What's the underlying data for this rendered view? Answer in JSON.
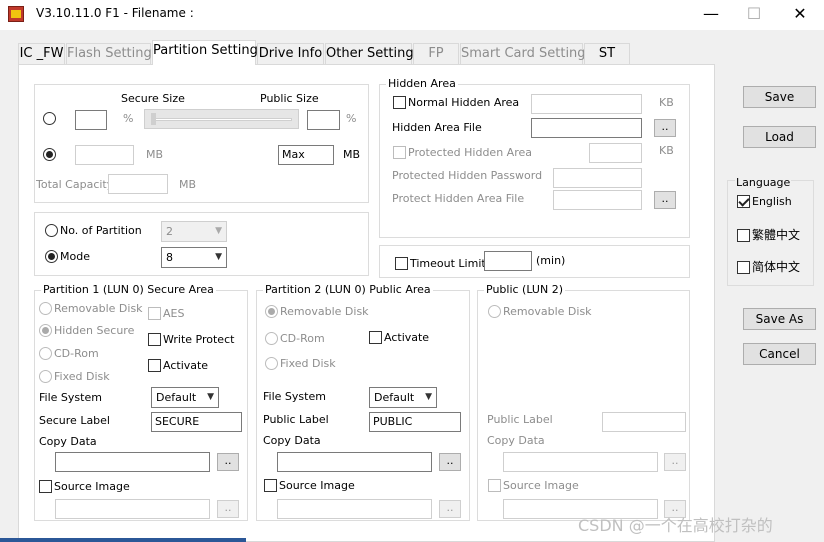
{
  "window": {
    "title": "V3.10.11.0 F1 - Filename :",
    "minimize": "—",
    "maximize": "☐",
    "close": "✕"
  },
  "tabs": [
    "IC _FW",
    "Flash Setting",
    "Partition Setting",
    "Drive Info",
    "Other Setting",
    "FP",
    "Smart Card Setting",
    "ST"
  ],
  "size": {
    "secure_size_label": "Secure Size",
    "public_size_label": "Public Size",
    "unit_percent": "%",
    "unit_mb": "MB",
    "public_value": "Max",
    "total_capacity_label": "Total Capacity",
    "total_capacity_unit": "MB"
  },
  "partition": {
    "no_of_partition_label": "No. of Partition",
    "no_of_partition_value": "2",
    "mode_label": "Mode",
    "mode_value": "8"
  },
  "hidden_area": {
    "title": "Hidden Area",
    "normal_hidden_area": "Normal Hidden Area",
    "kb1": "KB",
    "hidden_area_file": "Hidden Area File",
    "protected_hidden_area": "Protected Hidden Area",
    "kb2": "KB",
    "protected_hidden_password": "Protected Hidden Password",
    "protect_hidden_area_file": "Protect Hidden Area File"
  },
  "timeout": {
    "label": "Timeout Limit:",
    "unit": "(min)"
  },
  "p1": {
    "title": "Partition 1 (LUN 0) Secure Area",
    "removable_disk": "Removable Disk",
    "aes": "AES",
    "hidden_secure": "Hidden Secure",
    "write_protect": "Write Protect",
    "cd_rom": "CD-Rom",
    "activate": "Activate",
    "fixed_disk": "Fixed Disk",
    "file_system_label": "File System",
    "file_system_value": "Default",
    "label_label": "Secure Label",
    "label_value": "SECURE",
    "copy_data": "Copy Data",
    "source_image": "Source Image"
  },
  "p2": {
    "title": "Partition 2 (LUN 0) Public Area",
    "removable_disk": "Removable Disk",
    "cd_rom": "CD-Rom",
    "activate": "Activate",
    "fixed_disk": "Fixed Disk",
    "file_system_label": "File System",
    "file_system_value": "Default",
    "label_label": "Public Label",
    "label_value": "PUBLIC",
    "copy_data": "Copy Data",
    "source_image": "Source Image"
  },
  "p3": {
    "title": "Public (LUN 2)",
    "removable_disk": "Removable Disk",
    "label_label": "Public Label",
    "copy_data": "Copy Data",
    "source_image": "Source Image"
  },
  "browse": "..",
  "buttons": {
    "save": "Save",
    "load": "Load",
    "save_as": "Save As",
    "cancel": "Cancel"
  },
  "language": {
    "title": "Language",
    "english": "English",
    "trad_chinese": "繁體中文",
    "simp_chinese": "简体中文"
  },
  "watermark": "CSDN @一个在高校打杂的"
}
